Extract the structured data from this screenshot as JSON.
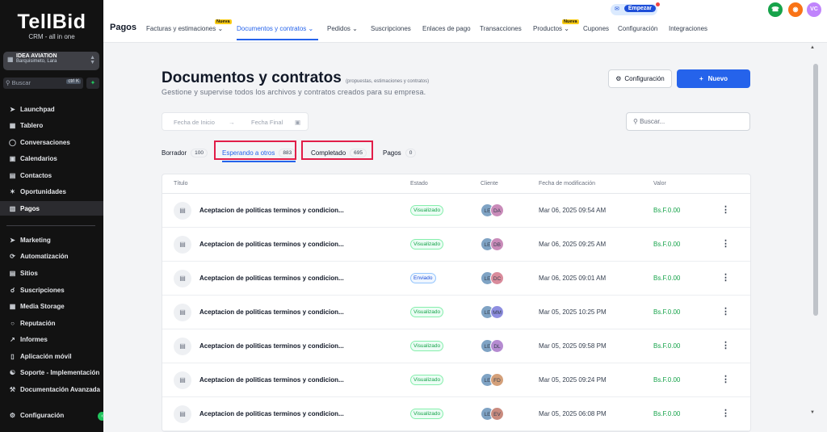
{
  "brand": {
    "name": "TellBid",
    "tagline": "CRM - all in one"
  },
  "account": {
    "name": "IDEA AVIATION",
    "location": "Barquisimeto, Lara"
  },
  "sidebar_search": {
    "placeholder": "Buscar",
    "shortcut": "ctrl K"
  },
  "sidebar": {
    "items": [
      {
        "label": "Launchpad",
        "icon": "rocket-icon"
      },
      {
        "label": "Tablero",
        "icon": "dashboard-icon"
      },
      {
        "label": "Conversaciones",
        "icon": "chat-icon"
      },
      {
        "label": "Calendarios",
        "icon": "calendar-icon"
      },
      {
        "label": "Contactos",
        "icon": "contacts-icon"
      },
      {
        "label": "Oportunidades",
        "icon": "opportunities-icon"
      },
      {
        "label": "Pagos",
        "icon": "payments-icon",
        "active": true
      },
      {
        "label": "Marketing",
        "icon": "send-icon"
      },
      {
        "label": "Automatización",
        "icon": "automation-icon"
      },
      {
        "label": "Sitios",
        "icon": "sites-icon"
      },
      {
        "label": "Suscripciones",
        "icon": "subscriptions-icon"
      },
      {
        "label": "Media Storage",
        "icon": "image-icon"
      },
      {
        "label": "Reputación",
        "icon": "reputation-icon"
      },
      {
        "label": "Informes",
        "icon": "reports-icon"
      },
      {
        "label": "Aplicación móvil",
        "icon": "mobile-icon"
      },
      {
        "label": "Soporte - Implementación",
        "icon": "support-icon"
      },
      {
        "label": "Documentación Avanzada",
        "icon": "tools-icon"
      }
    ],
    "settings_label": "Configuración"
  },
  "topbar": {
    "module": "Pagos",
    "tabs": [
      {
        "label": "Facturas y estimaciones",
        "badge": "Nueva",
        "dropdown": true
      },
      {
        "label": "Documentos y contratos",
        "dropdown": true,
        "active": true
      },
      {
        "label": "Pedidos",
        "dropdown": true
      },
      {
        "label": "Suscripciones"
      },
      {
        "label": "Enlaces de pago"
      },
      {
        "label": "Transacciones"
      },
      {
        "label": "Productos",
        "badge": "Nueva",
        "dropdown": true
      },
      {
        "label": "Cupones"
      },
      {
        "label": "Configuración"
      },
      {
        "label": "Integraciones"
      }
    ],
    "empezar_label": "Empezar",
    "user_initials": "VC"
  },
  "page": {
    "title": "Documentos y contratos",
    "title_note": "(propuestas, estimaciones y contratos)",
    "description": "Gestione y supervise todos los archivos y contratos creados para su empresa.",
    "config_button": "Configuración",
    "new_button": "Nuevo",
    "date_start_placeholder": "Fecha de Inicio",
    "date_end_placeholder": "Fecha Final",
    "search_placeholder": "Buscar..."
  },
  "status_tabs": [
    {
      "label": "Borrador",
      "count": "100"
    },
    {
      "label": "Esperando a otros",
      "count": "883",
      "active": true
    },
    {
      "label": "Completado",
      "count": "695"
    },
    {
      "label": "Pagos",
      "count": "0"
    }
  ],
  "table": {
    "columns": [
      "Título",
      "Estado",
      "Cliente",
      "Fecha de modificación",
      "Valor"
    ],
    "rows": [
      {
        "title": "Aceptacion de politicas terminos y condicion...",
        "status": "Visualizado",
        "client": [
          "LE",
          "DA"
        ],
        "date": "Mar 06, 2025 09:54 AM",
        "value": "Bs.F.0.00"
      },
      {
        "title": "Aceptacion de politicas terminos y condicion...",
        "status": "Visualizado",
        "client": [
          "LE",
          "DB"
        ],
        "date": "Mar 06, 2025 09:25 AM",
        "value": "Bs.F.0.00"
      },
      {
        "title": "Aceptacion de politicas terminos y condicion...",
        "status": "Enviado",
        "client": [
          "LE",
          "DC"
        ],
        "date": "Mar 06, 2025 09:01 AM",
        "value": "Bs.F.0.00"
      },
      {
        "title": "Aceptacion de politicas terminos y condicion...",
        "status": "Visualizado",
        "client": [
          "LE",
          "MM"
        ],
        "date": "Mar 05, 2025 10:25 PM",
        "value": "Bs.F.0.00"
      },
      {
        "title": "Aceptacion de politicas terminos y condicion...",
        "status": "Visualizado",
        "client": [
          "LE",
          "DL"
        ],
        "date": "Mar 05, 2025 09:58 PM",
        "value": "Bs.F.0.00"
      },
      {
        "title": "Aceptacion de politicas terminos y condicion...",
        "status": "Visualizado",
        "client": [
          "LE",
          "FD"
        ],
        "date": "Mar 05, 2025 09:24 PM",
        "value": "Bs.F.0.00"
      },
      {
        "title": "Aceptacion de politicas terminos y condicion...",
        "status": "Visualizado",
        "client": [
          "LE",
          "EV"
        ],
        "date": "Mar 05, 2025 06:08 PM",
        "value": "Bs.F.0.00"
      }
    ]
  },
  "colors": {
    "accent": "#2563eb",
    "highlight": "#e11d48",
    "value_green": "#16a34a",
    "sidebar_bg": "#121212"
  }
}
